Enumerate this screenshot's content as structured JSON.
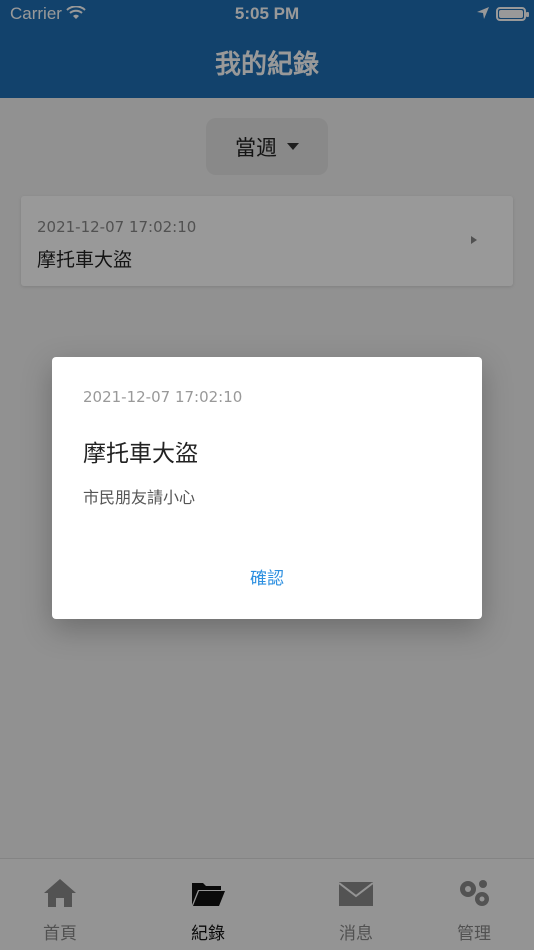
{
  "status_bar": {
    "carrier": "Carrier",
    "time": "5:05 PM"
  },
  "nav": {
    "title": "我的紀錄"
  },
  "filter": {
    "selected": "當週"
  },
  "records": [
    {
      "datetime": "2021-12-07 17:02:10",
      "title": "摩托車大盜"
    }
  ],
  "tabs": [
    {
      "label": "首頁",
      "icon": "home-icon"
    },
    {
      "label": "紀錄",
      "icon": "folder-icon",
      "active": true
    },
    {
      "label": "消息",
      "icon": "mail-icon"
    },
    {
      "label": "管理",
      "icon": "gears-icon"
    }
  ],
  "dialog": {
    "datetime": "2021-12-07 17:02:10",
    "title": "摩托車大盜",
    "message": "市民朋友請小心",
    "confirm_label": "確認"
  },
  "colors": {
    "header": "#1f6fb4",
    "accent": "#2c8fe0"
  }
}
